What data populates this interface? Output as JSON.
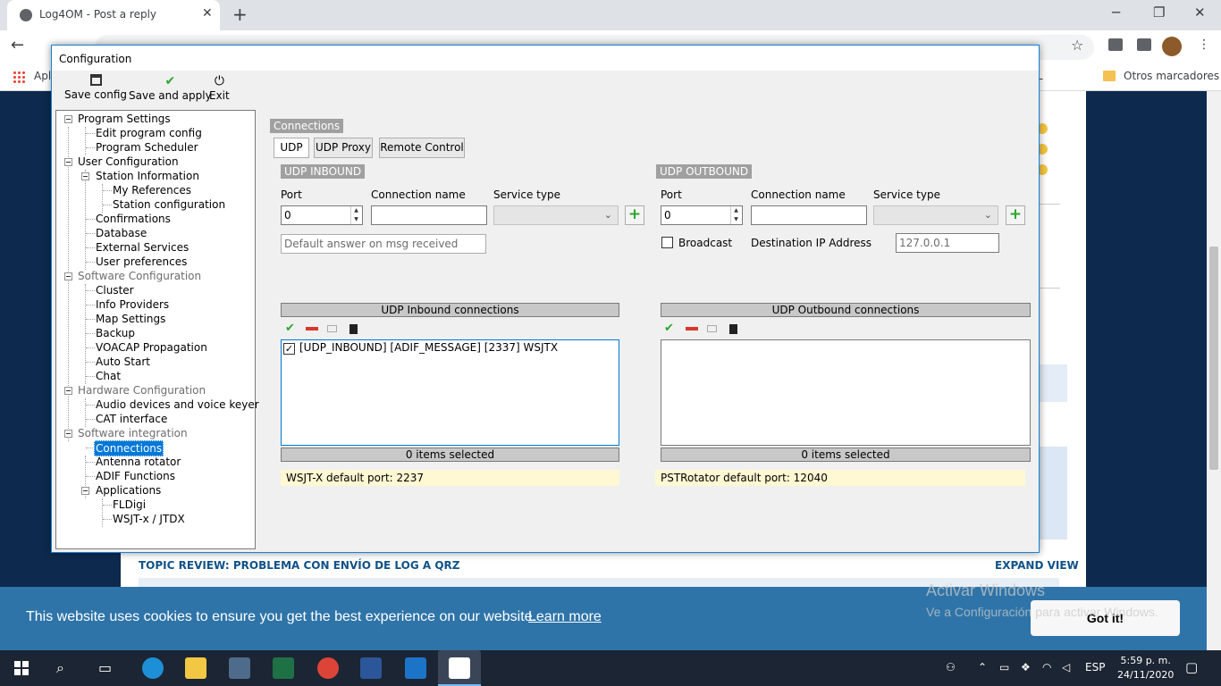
{
  "browser": {
    "tab_title": "Log4OM - Post a reply",
    "apps_label": "Apl",
    "bookmark_right": "L",
    "other_bookmarks": "Otros marcadores"
  },
  "page": {
    "topic_review": "TOPIC REVIEW: PROBLEMA CON ENVÍO DE LOG A QRZ",
    "expand_view": "EXPAND VIEW",
    "cookie_text": "This website uses cookies to ensure you get the best experience on our website.",
    "cookie_link": "Learn more",
    "cookie_button": "Got it!",
    "activate_title": "Activar Windows",
    "activate_sub": "Ve a Configuración para activar Windows."
  },
  "dialog": {
    "title": "Configuration",
    "toolbar": {
      "save_config": "Save config",
      "save_apply": "Save and apply",
      "exit": "Exit"
    },
    "tree": {
      "program_settings": "Program Settings",
      "edit_program_config": "Edit program config",
      "program_scheduler": "Program Scheduler",
      "user_configuration": "User Configuration",
      "station_information": "Station Information",
      "my_references": "My References",
      "station_configuration": "Station configuration",
      "confirmations": "Confirmations",
      "database": "Database",
      "external_services": "External Services",
      "user_preferences": "User preferences",
      "software_configuration": "Software Configuration",
      "cluster": "Cluster",
      "info_providers": "Info Providers",
      "map_settings": "Map Settings",
      "backup": "Backup",
      "voacap": "VOACAP Propagation",
      "auto_start": "Auto Start",
      "chat": "Chat",
      "hardware_configuration": "Hardware Configuration",
      "audio_devices": "Audio devices and voice keyer",
      "cat_interface": "CAT interface",
      "software_integration": "Software integration",
      "connections": "Connections",
      "antenna_rotator": "Antenna rotator",
      "adif_functions": "ADIF Functions",
      "applications": "Applications",
      "fldigi": "FLDigi",
      "wsjtx": "WSJT-x / JTDX"
    },
    "panel": {
      "section_label": "Connections",
      "tabs": [
        "UDP",
        "UDP Proxy",
        "Remote Control"
      ],
      "inbound": {
        "title": "UDP INBOUND",
        "port_label": "Port",
        "port_value": "0",
        "conn_name_label": "Connection name",
        "conn_name_value": "",
        "service_type_label": "Service type",
        "default_answer_placeholder": "Default answer on msg received",
        "list_header": "UDP Inbound connections",
        "items": [
          "[UDP_INBOUND] [ADIF_MESSAGE] [2337] WSJTX"
        ],
        "selected_count": "0 items selected",
        "hint": "WSJT-X default port: 2237"
      },
      "outbound": {
        "title": "UDP OUTBOUND",
        "port_label": "Port",
        "port_value": "0",
        "conn_name_label": "Connection name",
        "conn_name_value": "",
        "service_type_label": "Service type",
        "broadcast_label": "Broadcast",
        "dest_ip_label": "Destination IP Address",
        "dest_ip_value": "127.0.0.1",
        "list_header": "UDP Outbound connections",
        "selected_count": "0 items selected",
        "hint": "PSTRotator default port: 12040"
      }
    }
  },
  "taskbar": {
    "lang": "ESP",
    "time": "5:59 p. m.",
    "date": "24/11/2020"
  }
}
